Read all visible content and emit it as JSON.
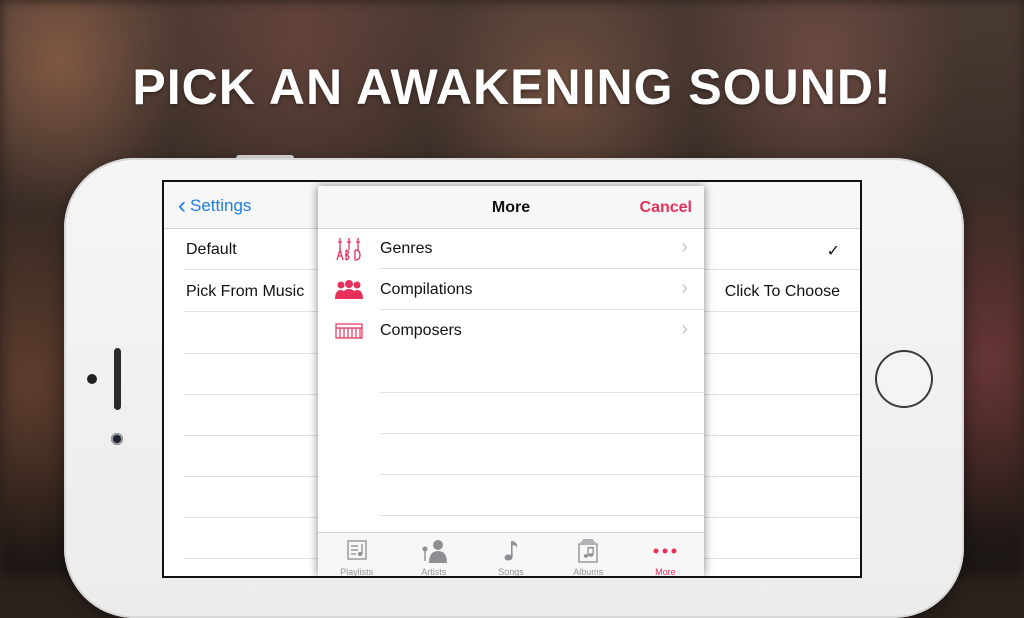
{
  "headline": "PICK AN AWAKENING SOUND!",
  "settings": {
    "back_label": "Settings",
    "rows": [
      {
        "label": "Default",
        "check": "✓"
      },
      {
        "label": "Pick From Music",
        "value": "Click To Choose"
      }
    ]
  },
  "more_panel": {
    "title": "More",
    "cancel_label": "Cancel",
    "items": [
      {
        "label": "Genres",
        "icon": "genres-icon"
      },
      {
        "label": "Compilations",
        "icon": "compilations-icon"
      },
      {
        "label": "Composers",
        "icon": "composers-icon"
      }
    ]
  },
  "tabbar": {
    "tabs": [
      {
        "label": "Playlists",
        "icon": "playlists-icon"
      },
      {
        "label": "Artists",
        "icon": "artists-icon"
      },
      {
        "label": "Songs",
        "icon": "songs-icon"
      },
      {
        "label": "Albums",
        "icon": "albums-icon"
      },
      {
        "label": "More",
        "icon": "more-icon",
        "active": true
      }
    ]
  },
  "colors": {
    "accent_blue": "#1a7fe6",
    "accent_pink": "#e8305b"
  }
}
